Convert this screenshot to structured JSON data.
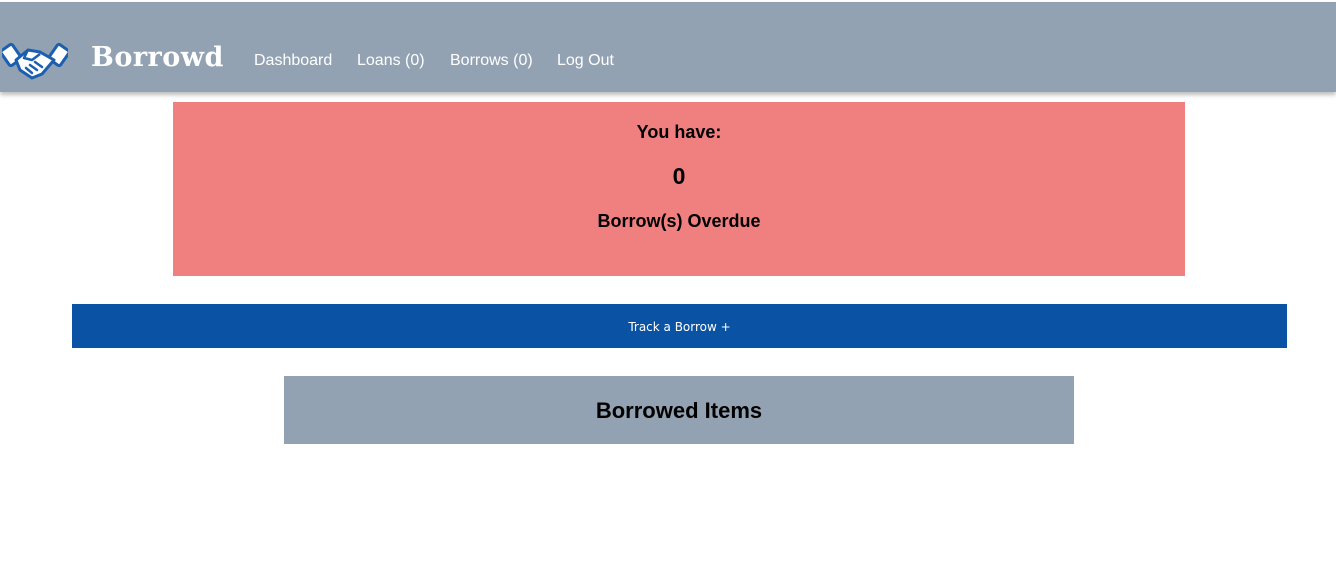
{
  "nav": {
    "brand": "Borrowd",
    "logo_icon": "handshake-icon",
    "links": [
      {
        "label": "Dashboard"
      },
      {
        "label": "Loans (0)"
      },
      {
        "label": "Borrows (0)"
      },
      {
        "label": "Log Out"
      }
    ]
  },
  "overdue": {
    "line1": "You have:",
    "count": "0",
    "line3": "Borrow(s) Overdue"
  },
  "actions": {
    "track_label": "Track a Borrow +"
  },
  "section": {
    "title": "Borrowed Items"
  },
  "colors": {
    "navbar": "#93a2b2",
    "overdue_bg": "#f08080",
    "primary_button": "#0a52a3",
    "section_header": "#93a2b2",
    "logo_blue": "#1c5fb0"
  }
}
